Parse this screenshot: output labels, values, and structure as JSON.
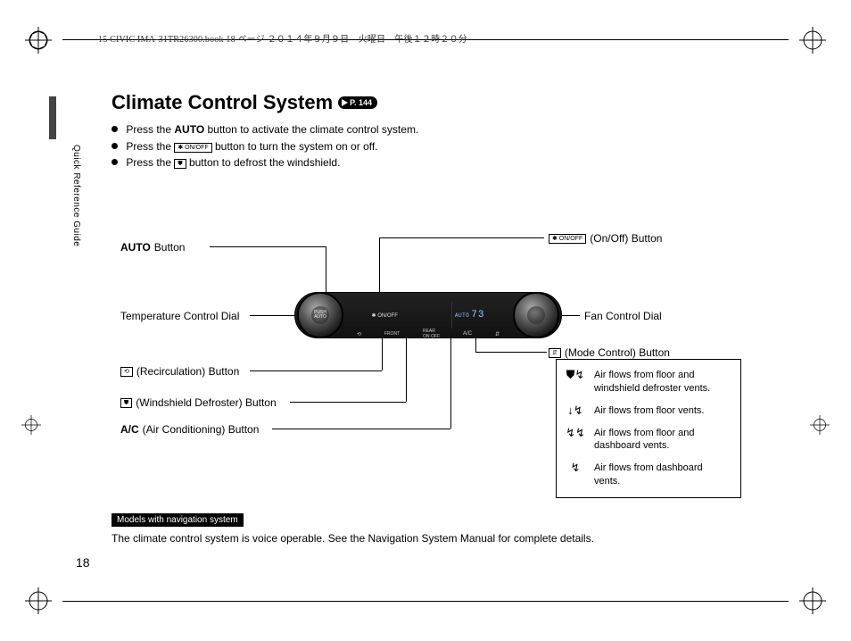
{
  "header_line": "15 CIVIC IMA-31TR26300.book  18 ページ  ２０１４年９月９日　火曜日　午後１２時２０分",
  "sidebar": "Quick Reference Guide",
  "title": "Climate Control System",
  "page_link": "P. 144",
  "bullets": {
    "b1_a": "Press the ",
    "b1_b": "AUTO",
    "b1_c": " button to activate the climate control system.",
    "b2_a": "Press the ",
    "b2_icon": "✱ ON/OFF",
    "b2_c": " button to turn the system on or off.",
    "b3_a": "Press the ",
    "b3_icon": "⛊",
    "b3_c": " button to defrost the windshield."
  },
  "panel": {
    "knob_left": "PUSH\nAUTO",
    "display_auto": "AUTO",
    "display_temp": "73",
    "btn_onoff": "✱ ON/OFF",
    "btn_recirc": "⟲",
    "btn_front": "FRONT",
    "btn_rear": "REAR\nON·OFF",
    "btn_ac": "A/C",
    "btn_mode": "⇵"
  },
  "callouts": {
    "auto_a": "AUTO",
    "auto_b": " Button",
    "temp": "Temperature Control Dial",
    "recirc_icon": "⟲",
    "recirc": " (Recirculation) Button",
    "defrost_icon": "⛊",
    "defrost": " (Windshield Defroster) Button",
    "ac_a": "A/C",
    "ac_b": " (Air Conditioning) Button",
    "onoff_icon": "✱ ON/OFF",
    "onoff": " (On/Off) Button",
    "fan": "Fan Control Dial",
    "mode_icon": "⇵",
    "mode": " (Mode Control) Button"
  },
  "legend": {
    "r1_icon": "⛊↯",
    "r1": "Air flows from floor and windshield defroster vents.",
    "r2_icon": "↓↯",
    "r2": "Air flows from floor vents.",
    "r3_icon": "↯↯",
    "r3": "Air flows from floor and dashboard vents.",
    "r4_icon": "↯",
    "r4": "Air flows from dashboard vents."
  },
  "footnote": {
    "badge": "Models with navigation system",
    "text": "The climate control system is voice operable. See the Navigation System Manual for complete details."
  },
  "page_number": "18"
}
